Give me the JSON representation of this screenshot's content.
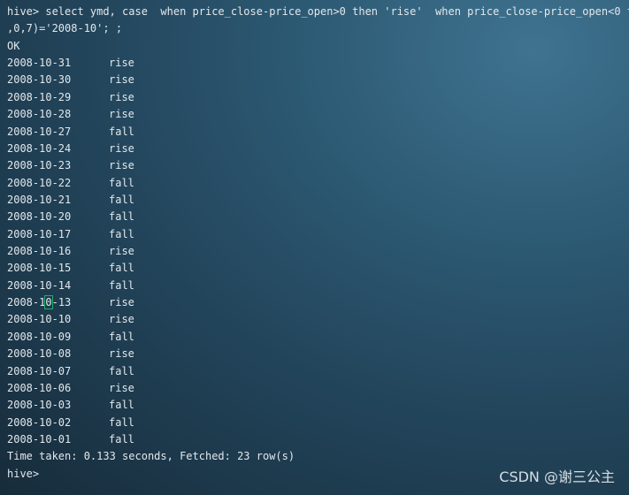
{
  "terminal": {
    "command_line_1": "hive> select ymd, case  when price_close-price_open>0 then 'rise'  when price_close-price_open<0 th",
    "command_line_2": ",0,7)='2008-10'; ;",
    "status": "OK",
    "rows": [
      {
        "date": "2008-10-31",
        "result": "rise"
      },
      {
        "date": "2008-10-30",
        "result": "rise"
      },
      {
        "date": "2008-10-29",
        "result": "rise"
      },
      {
        "date": "2008-10-28",
        "result": "rise"
      },
      {
        "date": "2008-10-27",
        "result": "fall"
      },
      {
        "date": "2008-10-24",
        "result": "rise"
      },
      {
        "date": "2008-10-23",
        "result": "rise"
      },
      {
        "date": "2008-10-22",
        "result": "fall"
      },
      {
        "date": "2008-10-21",
        "result": "fall"
      },
      {
        "date": "2008-10-20",
        "result": "fall"
      },
      {
        "date": "2008-10-17",
        "result": "fall"
      },
      {
        "date": "2008-10-16",
        "result": "rise"
      },
      {
        "date": "2008-10-15",
        "result": "fall"
      },
      {
        "date": "2008-10-14",
        "result": "fall"
      },
      {
        "date": "2008-10-13",
        "result": "rise"
      },
      {
        "date": "2008-10-10",
        "result": "rise"
      },
      {
        "date": "2008-10-09",
        "result": "fall"
      },
      {
        "date": "2008-10-08",
        "result": "rise"
      },
      {
        "date": "2008-10-07",
        "result": "fall"
      },
      {
        "date": "2008-10-06",
        "result": "rise"
      },
      {
        "date": "2008-10-03",
        "result": "fall"
      },
      {
        "date": "2008-10-02",
        "result": "fall"
      },
      {
        "date": "2008-10-01",
        "result": "fall"
      }
    ],
    "summary": "Time taken: 0.133 seconds, Fetched: 23 row(s)",
    "prompt": "hive>",
    "cursor_row": 14,
    "cursor_color": "#1fae6a"
  },
  "watermark": "CSDN @谢三公主"
}
